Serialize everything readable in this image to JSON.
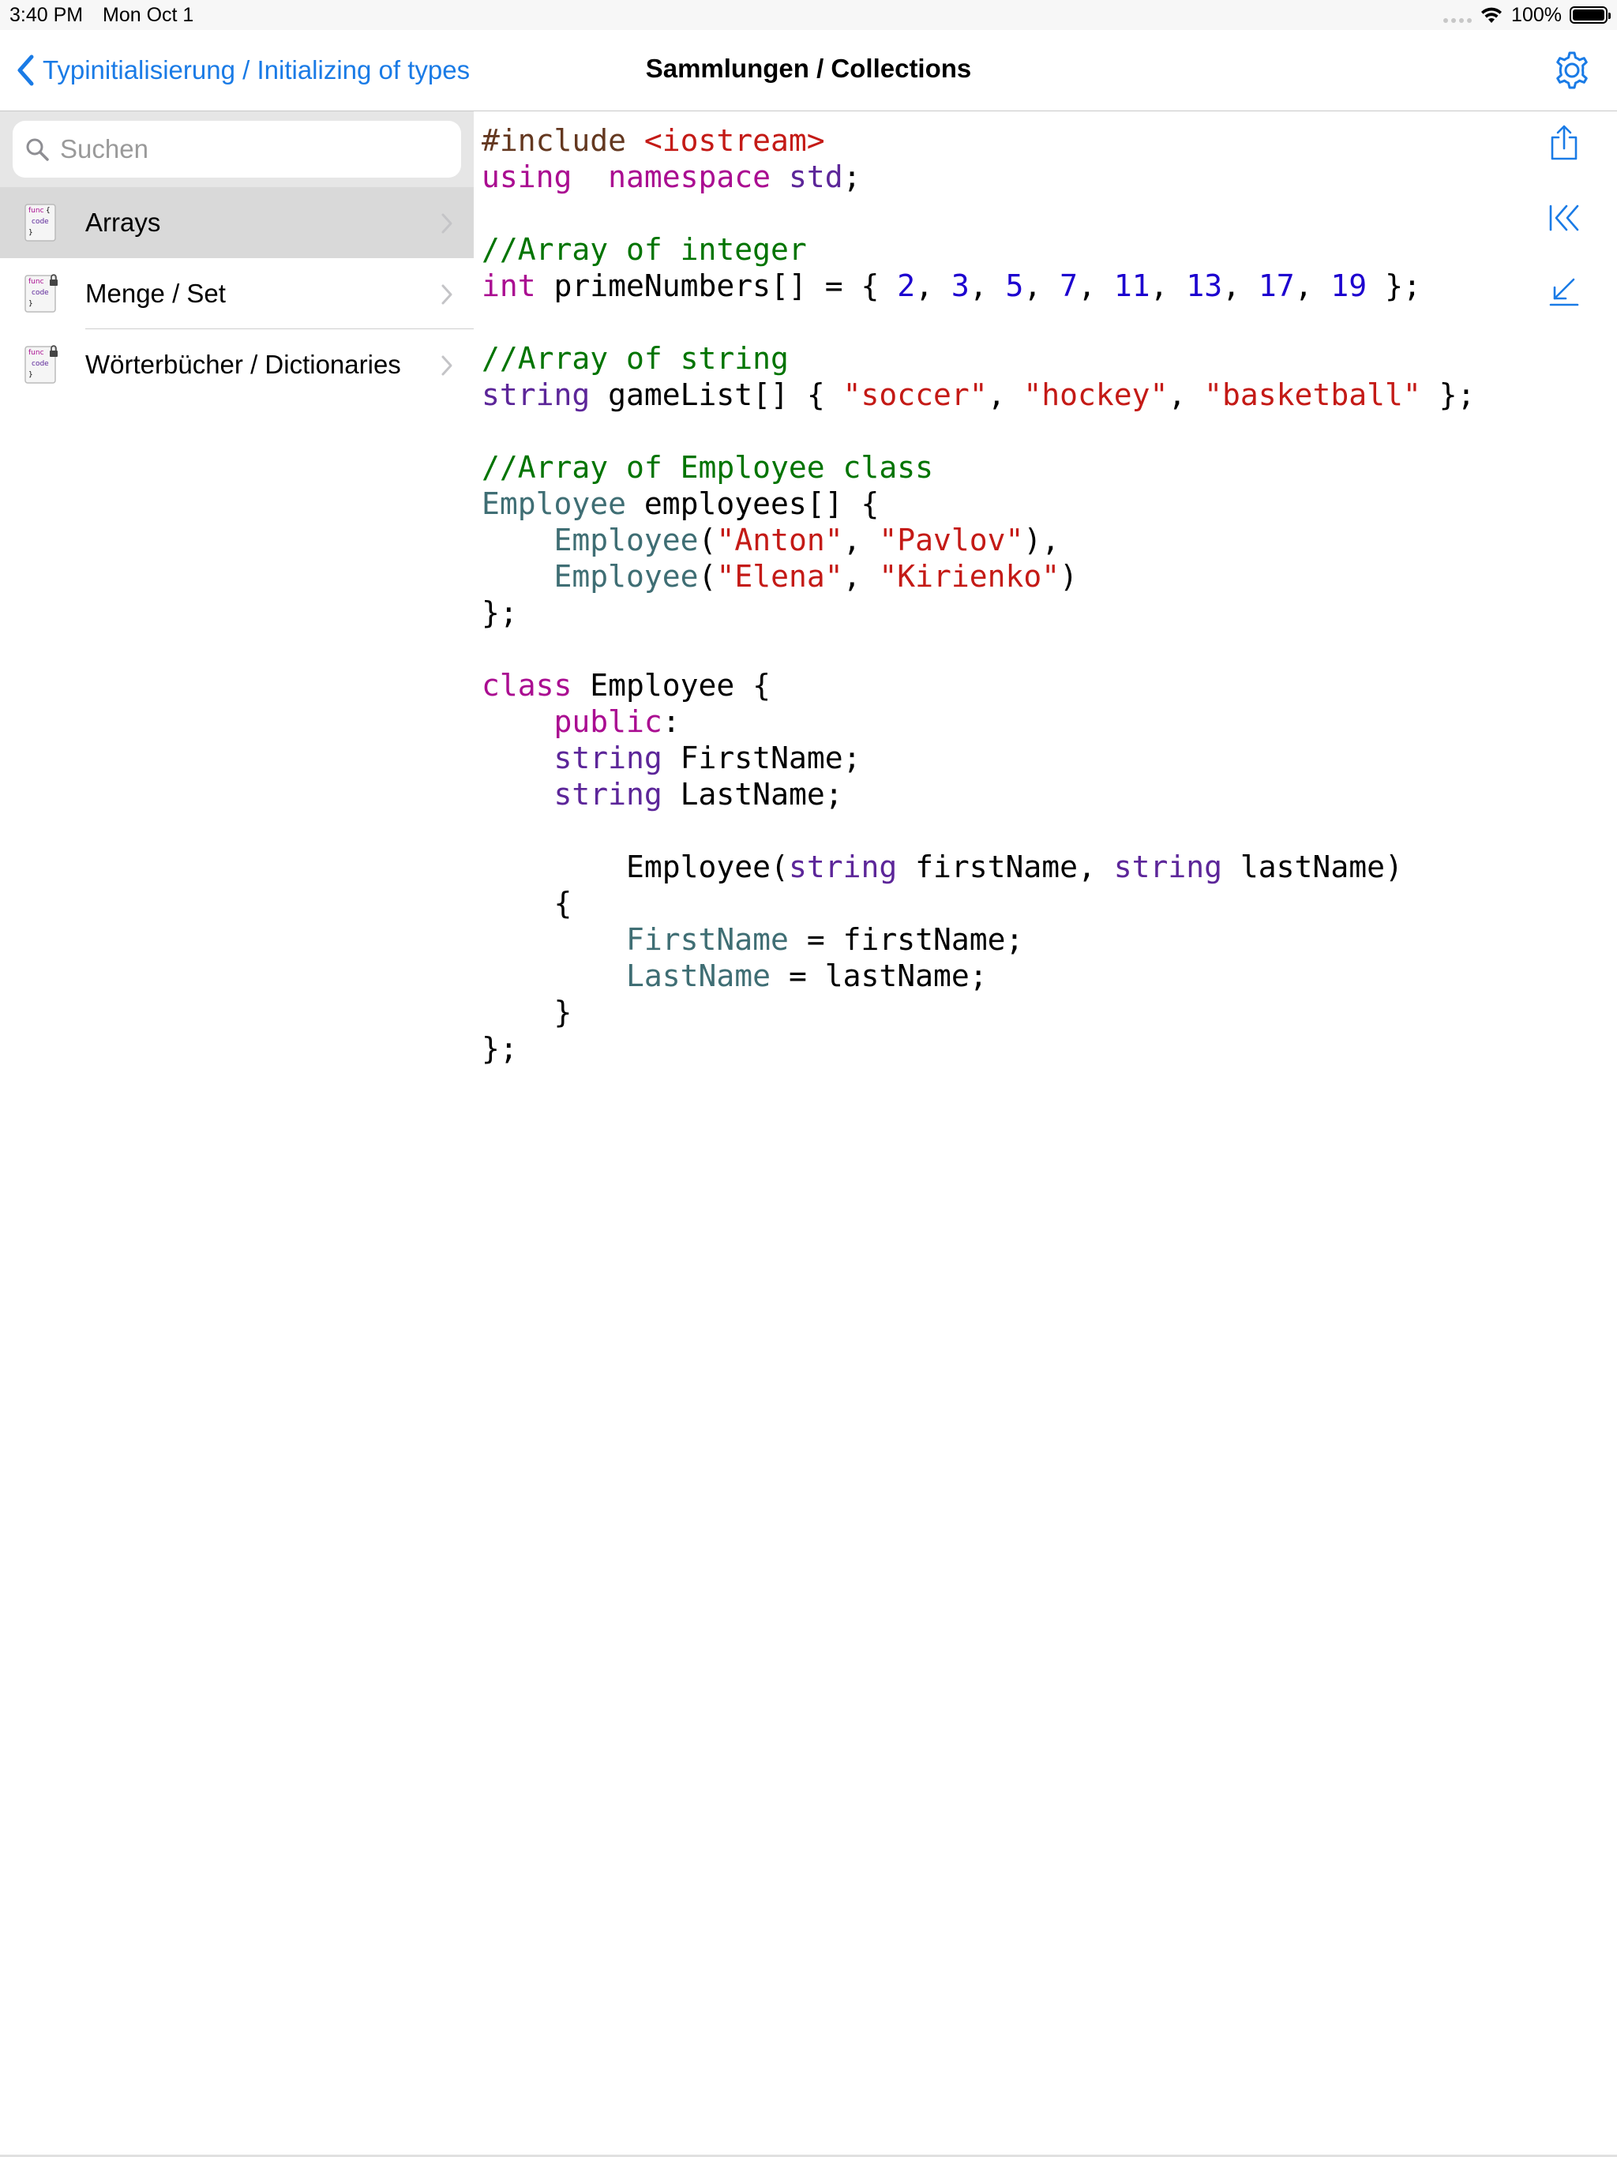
{
  "status_bar": {
    "time": "3:40 PM",
    "date": "Mon Oct 1",
    "battery": "100%",
    "battery_level": 1.0,
    "icons": [
      "signal-dots-icon",
      "wifi-icon",
      "battery-icon"
    ]
  },
  "nav": {
    "back_label": "Typinitialisierung / Initializing of types",
    "title": "Sammlungen / Collections",
    "accent_color": "#1a7be6"
  },
  "search": {
    "placeholder": "Suchen"
  },
  "sidebar": {
    "items": [
      {
        "label": "Arrays",
        "selected": true,
        "locked": false
      },
      {
        "label": "Menge / Set",
        "selected": false,
        "locked": true
      },
      {
        "label": "Wörterbücher / Dictionaries",
        "selected": false,
        "locked": true
      }
    ],
    "thumb_text": [
      "func",
      "{",
      "code",
      "}"
    ]
  },
  "toolbar": {
    "icons": [
      "share-icon",
      "first-page-icon",
      "jump-down-icon"
    ]
  },
  "code": {
    "lines": [
      [
        [
          "pp",
          "#include "
        ],
        [
          "st",
          "<iostream>"
        ]
      ],
      [
        [
          "kw",
          "using"
        ],
        [
          "",
          "  "
        ],
        [
          "kw",
          "namespace"
        ],
        [
          "",
          " "
        ],
        [
          "ty",
          "std"
        ],
        [
          "",
          ";"
        ]
      ],
      [],
      [
        [
          "cm",
          "//Array of integer"
        ]
      ],
      [
        [
          "kw",
          "int"
        ],
        [
          "",
          " primeNumbers[] = { "
        ],
        [
          "nu",
          "2"
        ],
        [
          "",
          ", "
        ],
        [
          "nu",
          "3"
        ],
        [
          "",
          ", "
        ],
        [
          "nu",
          "5"
        ],
        [
          "",
          ", "
        ],
        [
          "nu",
          "7"
        ],
        [
          "",
          ", "
        ],
        [
          "nu",
          "11"
        ],
        [
          "",
          ", "
        ],
        [
          "nu",
          "13"
        ],
        [
          "",
          ", "
        ],
        [
          "nu",
          "17"
        ],
        [
          "",
          ", "
        ],
        [
          "nu",
          "19"
        ],
        [
          "",
          " };"
        ]
      ],
      [],
      [
        [
          "cm",
          "//Array of string"
        ]
      ],
      [
        [
          "ty",
          "string"
        ],
        [
          "",
          " gameList[] { "
        ],
        [
          "st",
          "\"soccer\""
        ],
        [
          "",
          ", "
        ],
        [
          "st",
          "\"hockey\""
        ],
        [
          "",
          ", "
        ],
        [
          "st",
          "\"basketball\""
        ],
        [
          "",
          " };"
        ]
      ],
      [],
      [
        [
          "cm",
          "//Array of Employee class"
        ]
      ],
      [
        [
          "cls",
          "Employee"
        ],
        [
          "",
          " employees[] {"
        ]
      ],
      [
        [
          "",
          "    "
        ],
        [
          "cls",
          "Employee"
        ],
        [
          "",
          "("
        ],
        [
          "st",
          "\"Anton\""
        ],
        [
          "",
          ", "
        ],
        [
          "st",
          "\"Pavlov\""
        ],
        [
          "",
          "),"
        ]
      ],
      [
        [
          "",
          "    "
        ],
        [
          "cls",
          "Employee"
        ],
        [
          "",
          "("
        ],
        [
          "st",
          "\"Elena\""
        ],
        [
          "",
          ", "
        ],
        [
          "st",
          "\"Kirienko\""
        ],
        [
          "",
          ")"
        ]
      ],
      [
        [
          "",
          "};"
        ]
      ],
      [],
      [
        [
          "kw",
          "class"
        ],
        [
          "",
          " Employee {"
        ]
      ],
      [
        [
          "",
          "    "
        ],
        [
          "kw",
          "public"
        ],
        [
          "",
          ":"
        ]
      ],
      [
        [
          "",
          "    "
        ],
        [
          "ty",
          "string"
        ],
        [
          "",
          " FirstName;"
        ]
      ],
      [
        [
          "",
          "    "
        ],
        [
          "ty",
          "string"
        ],
        [
          "",
          " LastName;"
        ]
      ],
      [],
      [
        [
          "",
          "        Employee("
        ],
        [
          "ty",
          "string"
        ],
        [
          "",
          " firstName, "
        ],
        [
          "ty",
          "string"
        ],
        [
          "",
          " lastName)"
        ]
      ],
      [
        [
          "",
          "    {"
        ]
      ],
      [
        [
          "",
          "        "
        ],
        [
          "cls",
          "FirstName"
        ],
        [
          "",
          " = firstName;"
        ]
      ],
      [
        [
          "",
          "        "
        ],
        [
          "cls",
          "LastName"
        ],
        [
          "",
          " = lastName;"
        ]
      ],
      [
        [
          "",
          "    }"
        ]
      ],
      [
        [
          "",
          "};"
        ]
      ]
    ]
  }
}
